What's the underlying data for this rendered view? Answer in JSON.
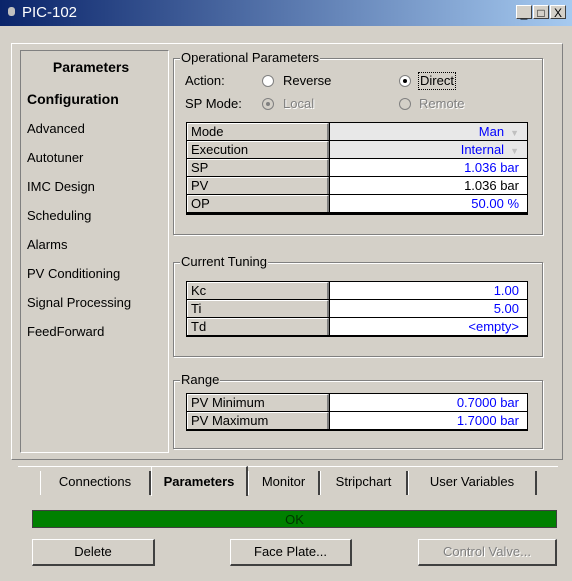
{
  "window": {
    "title": "PIC-102",
    "minimize": "_",
    "restore": "□",
    "close": "X"
  },
  "sidebar": {
    "header": "Parameters",
    "items": [
      {
        "label": "Configuration",
        "selected": true
      },
      {
        "label": "Advanced"
      },
      {
        "label": "Autotuner"
      },
      {
        "label": "IMC Design"
      },
      {
        "label": "Scheduling"
      },
      {
        "label": "Alarms"
      },
      {
        "label": "PV Conditioning"
      },
      {
        "label": "Signal Processing"
      },
      {
        "label": "FeedForward"
      }
    ]
  },
  "operational": {
    "group_label": "Operational Parameters",
    "action_label": "Action:",
    "action_options": [
      {
        "label": "Reverse",
        "selected": false
      },
      {
        "label": "Direct",
        "selected": true
      }
    ],
    "sp_mode_label": "SP Mode:",
    "sp_mode_options": [
      {
        "label": "Local",
        "selected": true,
        "disabled": true
      },
      {
        "label": "Remote",
        "selected": false,
        "disabled": true
      }
    ],
    "rows": [
      {
        "name": "Mode",
        "value": "Man",
        "dropdown": true
      },
      {
        "name": "Execution",
        "value": "Internal",
        "dropdown": true
      },
      {
        "name": "SP",
        "value": "1.036 bar"
      },
      {
        "name": "PV",
        "value": "1.036 bar"
      },
      {
        "name": "OP",
        "value": "50.00 %"
      }
    ]
  },
  "tuning": {
    "group_label": "Current Tuning",
    "rows": [
      {
        "name": "Kc",
        "value": "1.00"
      },
      {
        "name": "Ti",
        "value": "5.00"
      },
      {
        "name": "Td",
        "value": "<empty>"
      }
    ]
  },
  "range": {
    "group_label": "Range",
    "rows": [
      {
        "name": "PV Minimum",
        "value": "0.7000 bar"
      },
      {
        "name": "PV Maximum",
        "value": "1.7000 bar"
      }
    ]
  },
  "tabs": [
    {
      "label": "Connections",
      "active": false
    },
    {
      "label": "Parameters",
      "active": true
    },
    {
      "label": "Monitor",
      "active": false
    },
    {
      "label": "Stripchart",
      "active": false
    },
    {
      "label": "User Variables",
      "active": false
    }
  ],
  "status": {
    "text": "OK",
    "color": "#008000"
  },
  "buttons": {
    "delete": "Delete",
    "face_plate": "Face Plate...",
    "control_valve": "Control Valve..."
  }
}
